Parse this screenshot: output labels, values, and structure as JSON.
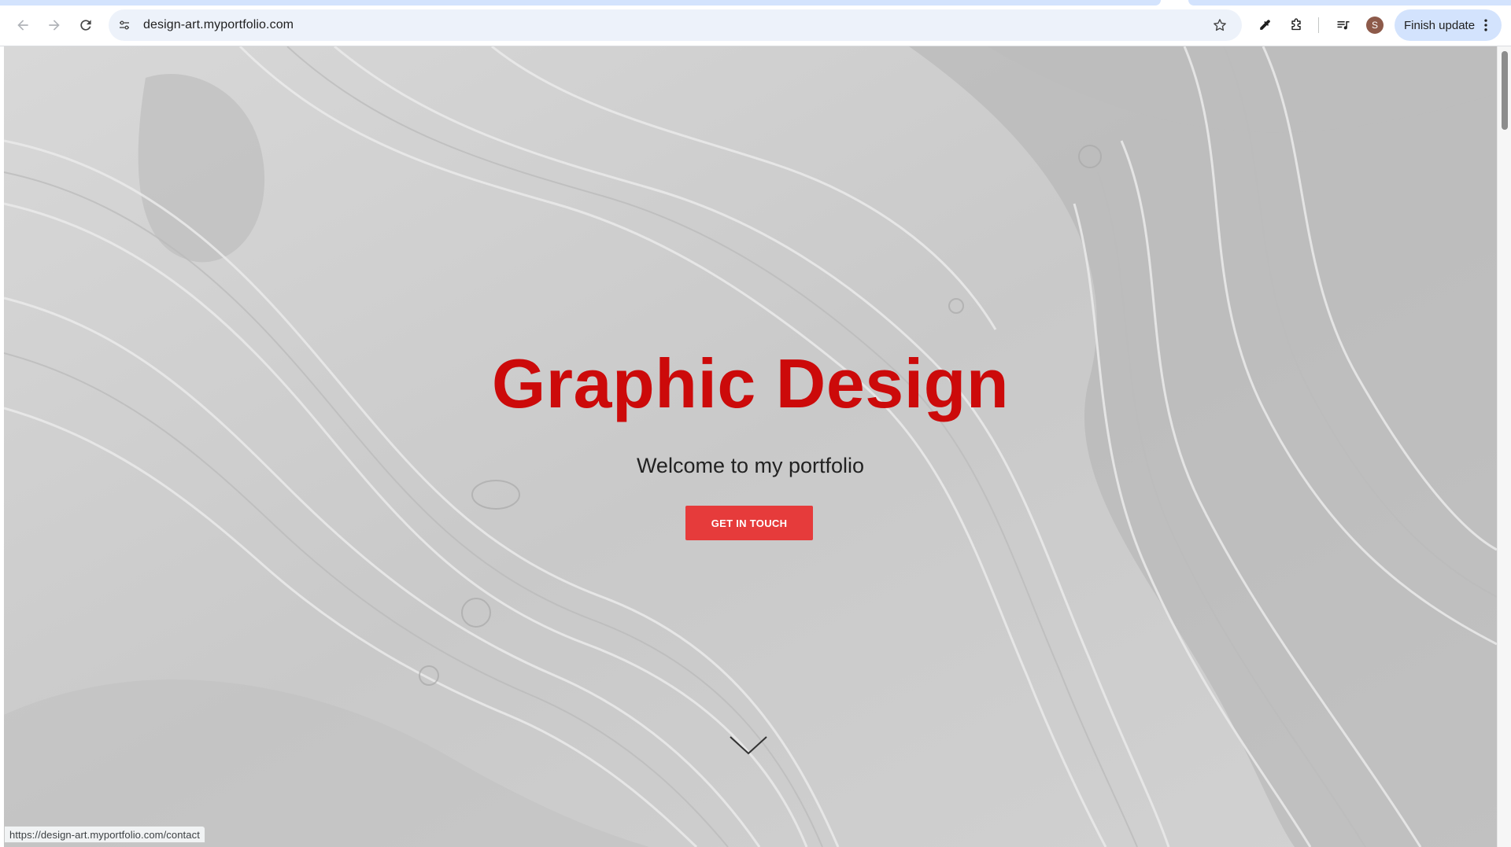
{
  "browser": {
    "url": "design-art.myportfolio.com",
    "finish_update_label": "Finish update",
    "profile_initial": "S",
    "status_url": "https://design-art.myportfolio.com/contact",
    "icons": {
      "back": "arrow-left-icon",
      "forward": "arrow-right-icon",
      "reload": "reload-icon",
      "site_info": "tune-icon",
      "bookmark": "star-icon",
      "eyedropper": "eyedropper-icon",
      "extensions": "puzzle-icon",
      "reading_list": "media-queue-icon",
      "menu": "more-vertical-icon"
    }
  },
  "page": {
    "title": "Graphic Design",
    "subtitle": "Welcome to my portfolio",
    "cta_label": "GET IN TOUCH",
    "scroll_icon": "chevron-down-icon"
  },
  "colors": {
    "title": "#cc0a0a",
    "cta_background": "#e63b3b",
    "finish_update_background": "#d3e3fd",
    "omnibox_background": "#edf2fa"
  }
}
